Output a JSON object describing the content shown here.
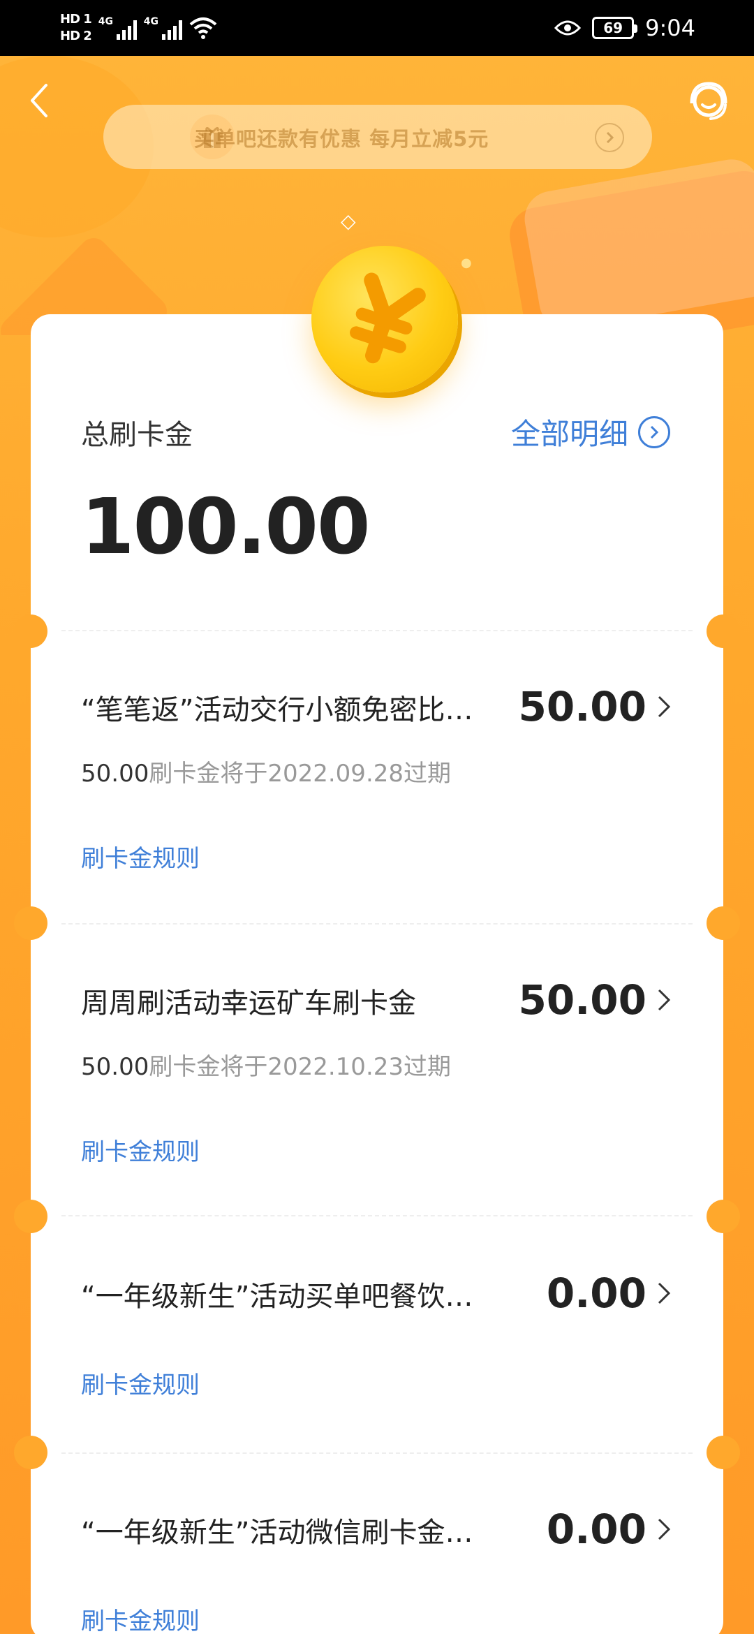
{
  "status_bar": {
    "hd1": "HD 1",
    "hd2": "HD 2",
    "net1": "4G",
    "net2": "4G",
    "battery": "69",
    "time": "9:04"
  },
  "promo": {
    "text": "买单吧还款有优惠 每月立减5元"
  },
  "summary": {
    "label": "总刷卡金",
    "detail_link": "全部明细",
    "total": "100.00"
  },
  "items": [
    {
      "title": "“笔笔返”活动交行小额免密比…",
      "amount": "50.00",
      "expiry_amount": "50.00",
      "expiry_text": "刷卡金将于2022.09.28过期",
      "rule": "刷卡金规则"
    },
    {
      "title": "周周刷活动幸运矿车刷卡金",
      "amount": "50.00",
      "expiry_amount": "50.00",
      "expiry_text": "刷卡金将于2022.10.23过期",
      "rule": "刷卡金规则"
    },
    {
      "title": "“一年级新生”活动买单吧餐饮…",
      "amount": "0.00",
      "rule": "刷卡金规则"
    },
    {
      "title": "“一年级新生”活动微信刷卡金…",
      "amount": "0.00",
      "rule": "刷卡金规则"
    }
  ],
  "colors": {
    "accent_orange": "#ffa82c",
    "link_blue": "#3f7fd8",
    "coin_yellow": "#ffcc14"
  },
  "icons": {
    "back": "back-arrow-icon",
    "service": "customer-service-icon",
    "gift": "gift-icon",
    "coin": "yuan-coin-icon"
  }
}
